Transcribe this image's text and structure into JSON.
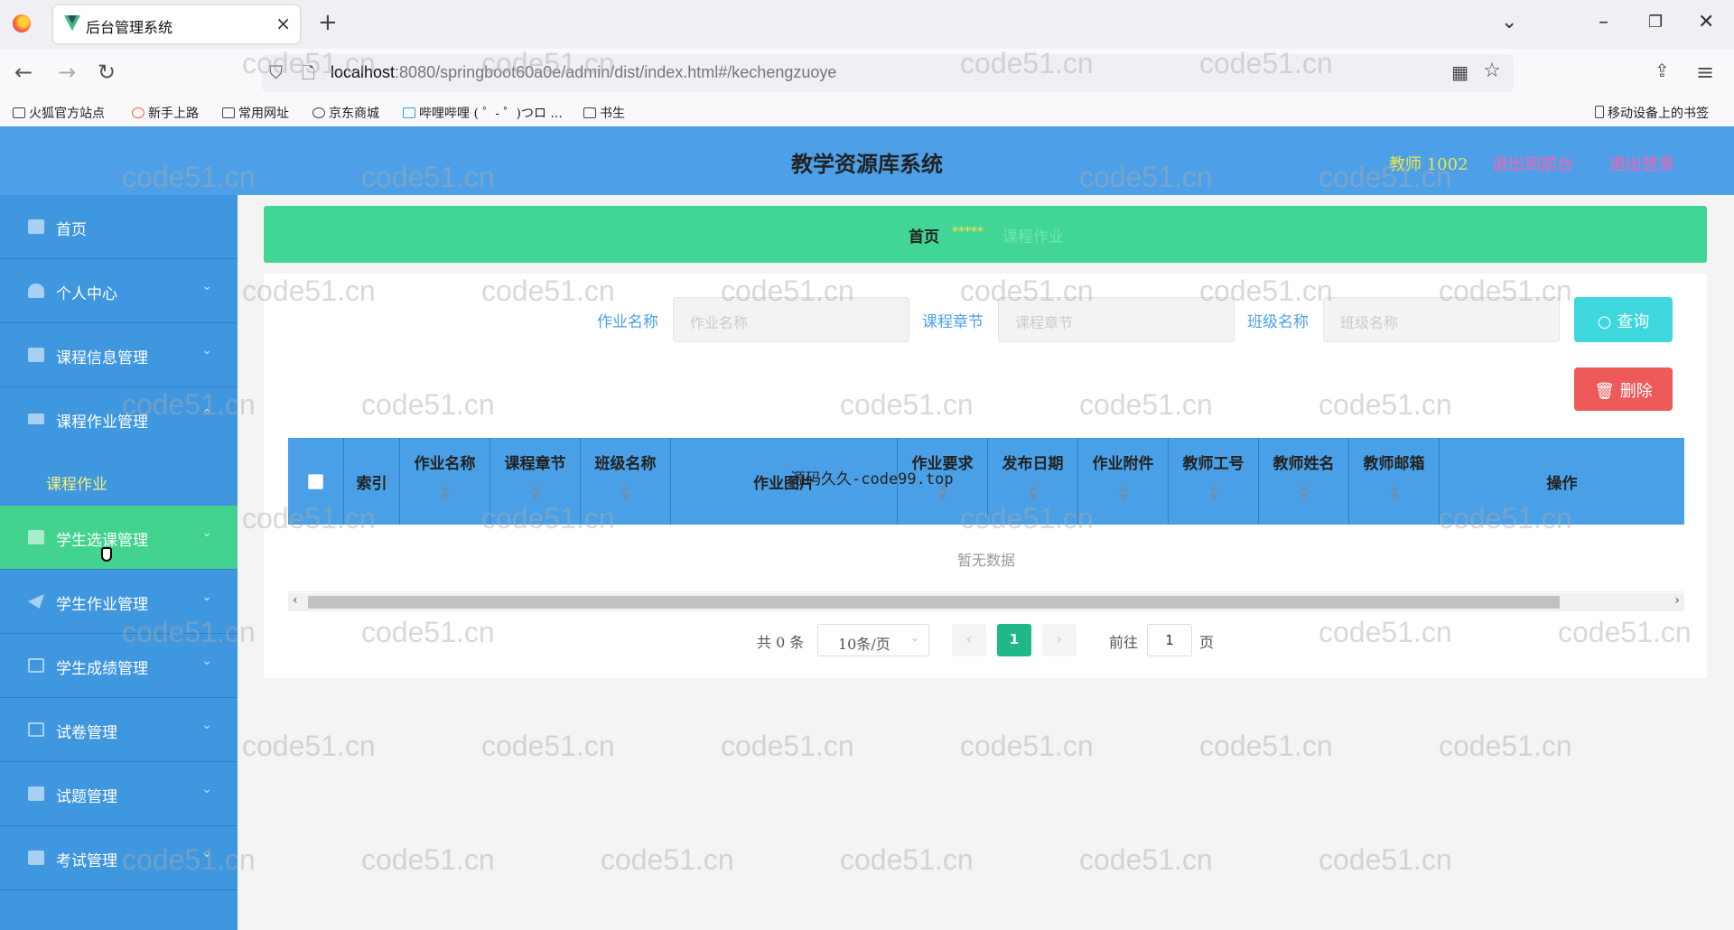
{
  "browser": {
    "tab_title": "后台管理系统",
    "url_host": "localhost",
    "url_rest": ":8080/springboot60a0e/admin/dist/index.html#/kechengzuoye",
    "bookmarks": [
      "火狐官方站点",
      "新手上路",
      "常用网址",
      "京东商城",
      "哔哩哔哩 ( ゜- ゜)つロ ...",
      "书生"
    ],
    "mobile_bookmarks": "移动设备上的书签"
  },
  "header": {
    "title": "教学资源库系统",
    "user": "教师 1002",
    "back_to_front": "退出到前台",
    "logout": "退出登录"
  },
  "sidebar": {
    "items": [
      {
        "label": "首页"
      },
      {
        "label": "个人中心"
      },
      {
        "label": "课程信息管理"
      },
      {
        "label": "课程作业管理"
      },
      {
        "label": "课程作业"
      },
      {
        "label": "学生选课管理"
      },
      {
        "label": "学生作业管理"
      },
      {
        "label": "学生成绩管理"
      },
      {
        "label": "试卷管理"
      },
      {
        "label": "试题管理"
      },
      {
        "label": "考试管理"
      }
    ]
  },
  "breadcrumb": {
    "home": "首页",
    "sep": "*****",
    "current": "课程作业"
  },
  "search": {
    "fields": [
      {
        "label": "作业名称",
        "placeholder": "作业名称"
      },
      {
        "label": "课程章节",
        "placeholder": "课程章节"
      },
      {
        "label": "班级名称",
        "placeholder": "班级名称"
      }
    ],
    "query_label": "查询",
    "delete_label": "删除"
  },
  "table": {
    "columns": [
      "索引",
      "作业名称",
      "课程章节",
      "班级名称",
      "作业图片",
      "作业要求",
      "发布日期",
      "作业附件",
      "教师工号",
      "教师姓名",
      "教师邮箱",
      "操作"
    ],
    "empty_text": "暂无数据",
    "overlay_text": "源码久久-code99.top"
  },
  "pagination": {
    "total": "共 0 条",
    "page_size": "10条/页",
    "current_page": "1",
    "goto_label": "前往",
    "goto_value": "1",
    "page_suffix": "页"
  },
  "watermark": "code51.cn",
  "colors": {
    "header": "#4da0e8",
    "sidebar": "#3f97e0",
    "active": "#42d38f",
    "accent": "#20b889"
  }
}
